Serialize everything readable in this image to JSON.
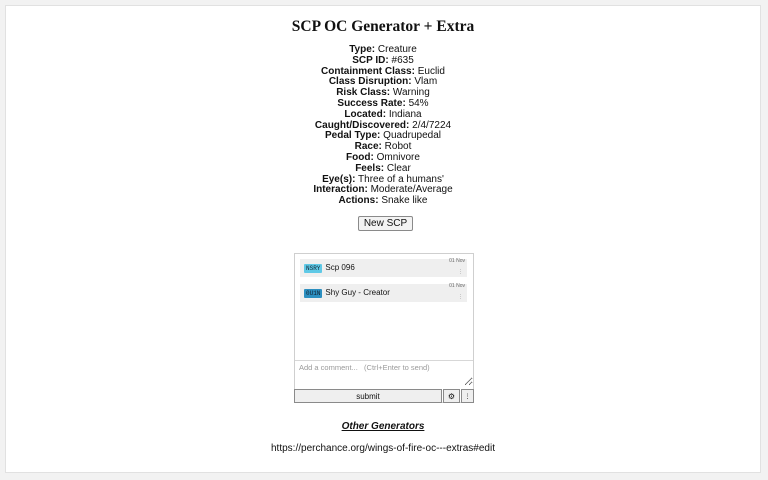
{
  "title": "SCP OC Generator + Extra",
  "fields": [
    {
      "label": "Type:",
      "value": "Creature"
    },
    {
      "label": "SCP ID:",
      "value": "#635"
    },
    {
      "label": "Containment Class:",
      "value": "Euclid"
    },
    {
      "label": "Class Disruption:",
      "value": "Vlam"
    },
    {
      "label": "Risk Class:",
      "value": "Warning"
    },
    {
      "label": "Success Rate:",
      "value": "54%"
    },
    {
      "label": "Located:",
      "value": "Indiana"
    },
    {
      "label": "Caught/Discovered:",
      "value": "2/4/7224"
    },
    {
      "label": "Pedal Type:",
      "value": "Quadrupedal"
    },
    {
      "label": "Race:",
      "value": "Robot"
    },
    {
      "label": "Food:",
      "value": "Omnivore"
    },
    {
      "label": "Feels:",
      "value": "Clear"
    },
    {
      "label": "Eye(s):",
      "value": "Three of a humans'"
    },
    {
      "label": "Interaction:",
      "value": "Moderate/Average"
    },
    {
      "label": "Actions:",
      "value": "Snake like"
    }
  ],
  "new_button": "New SCP",
  "comments": {
    "messages": [
      {
        "badge": "NSRY",
        "badge_color": "#5fc9e6",
        "name": "Scp 096",
        "time": "01 Nov",
        "more": "⋮"
      },
      {
        "badge": "0U1N",
        "badge_color": "#2c8fc0",
        "name": "Shy Guy - Creator",
        "time": "01 Nov",
        "more": "⋮"
      }
    ],
    "placeholder": "Add a comment...   (Ctrl+Enter to send)",
    "submit_label": "submit",
    "gear_label": "⚙",
    "more_label": "⋮"
  },
  "other_generators": "Other Generators",
  "url": "https://perchance.org/wings-of-fire-oc---extras#edit"
}
